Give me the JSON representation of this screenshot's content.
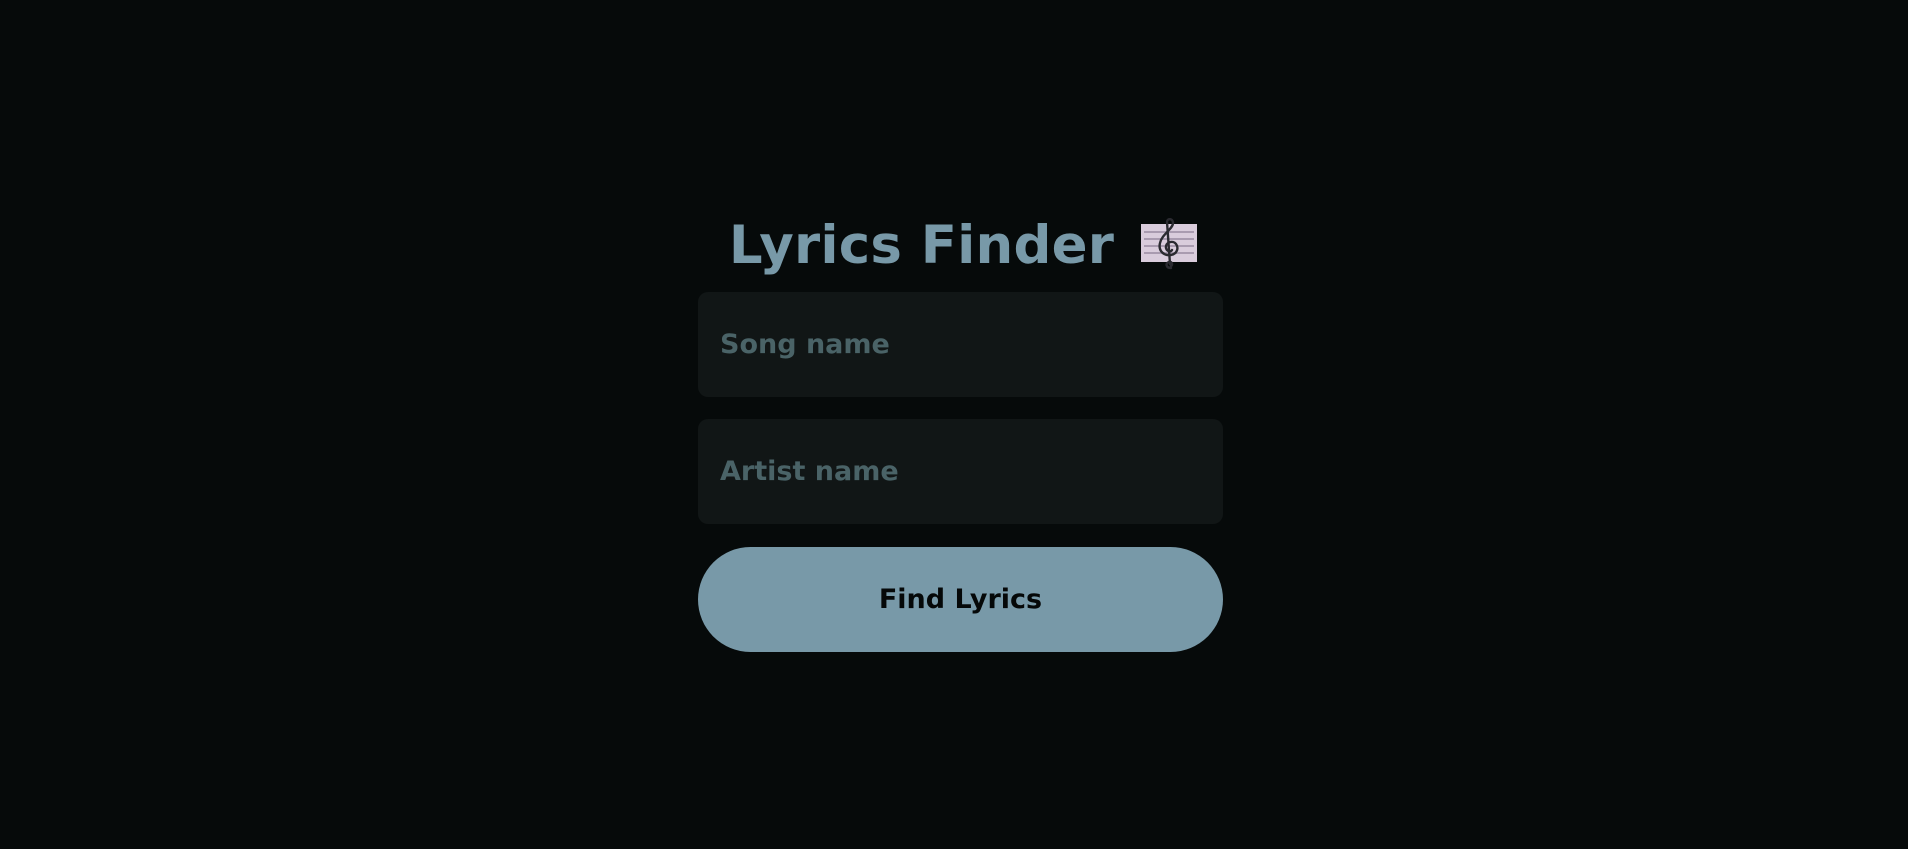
{
  "app": {
    "title": "Lyrics Finder",
    "title_icon": "musical-score-icon"
  },
  "form": {
    "song_placeholder": "Song name",
    "song_value": "",
    "artist_placeholder": "Artist name",
    "artist_value": "",
    "submit_label": "Find Lyrics"
  },
  "colors": {
    "background": "#060a0a",
    "accent": "#7899a8",
    "field_background": "#111616",
    "placeholder": "#4a6367",
    "button_text": "#050808"
  }
}
